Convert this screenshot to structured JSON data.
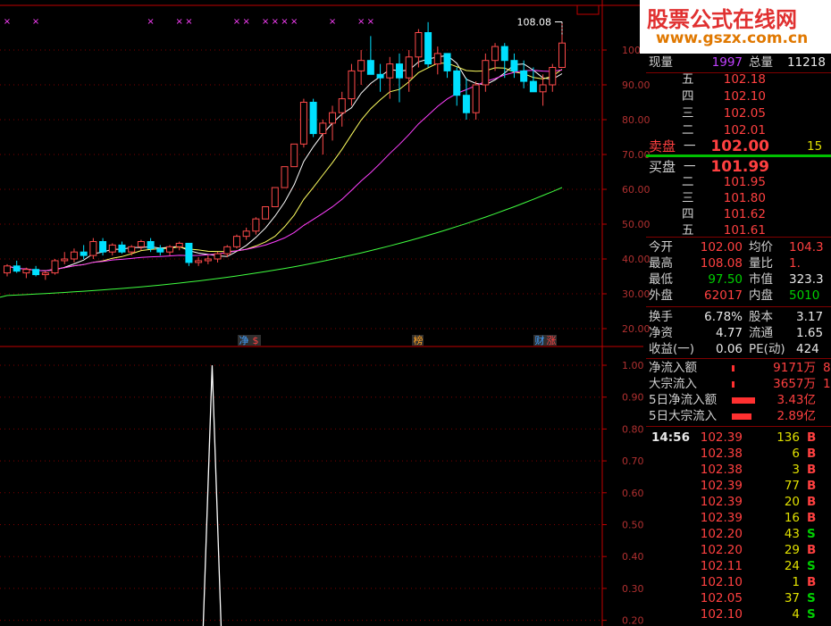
{
  "watermark": {
    "line1": "股票公式在线网",
    "line2": "www.gszx.com.cn"
  },
  "chart_data": {
    "type": "candlestick",
    "high_marker": "108.08",
    "price_axis": [
      "100.00",
      "90.00",
      "80.00",
      "70.00",
      "60.00",
      "50.00",
      "40.00",
      "30.00",
      "20.00"
    ],
    "indicator_axis": [
      "1.00",
      "0.90",
      "0.80",
      "0.70",
      "0.60",
      "0.50",
      "0.40",
      "0.30",
      "0.20"
    ],
    "event_tags": [
      "净",
      "$",
      "榜",
      "财",
      "涨"
    ],
    "candles": [
      [
        36,
        38.5,
        35,
        38
      ],
      [
        38,
        39.5,
        36,
        36.5
      ],
      [
        36,
        37.5,
        34.5,
        37
      ],
      [
        37,
        38,
        35,
        35.5
      ],
      [
        35.5,
        36.5,
        34,
        36
      ],
      [
        36,
        40,
        35.5,
        39.5
      ],
      [
        39.5,
        42,
        38.5,
        40
      ],
      [
        40,
        43,
        39,
        42
      ],
      [
        42,
        44,
        40,
        41
      ],
      [
        41,
        46,
        40,
        45
      ],
      [
        45,
        46,
        41,
        42
      ],
      [
        42,
        44.5,
        41,
        44
      ],
      [
        44,
        45,
        41.5,
        42
      ],
      [
        42,
        44,
        41,
        43.5
      ],
      [
        43.5,
        45.5,
        42.5,
        45
      ],
      [
        45,
        46,
        42,
        43
      ],
      [
        43,
        44,
        41,
        42
      ],
      [
        42,
        44,
        41,
        43.5
      ],
      [
        43.5,
        45,
        42.5,
        44.5
      ],
      [
        44.5,
        44.5,
        38,
        39
      ],
      [
        39,
        40.5,
        38,
        39.5
      ],
      [
        39.5,
        41,
        38.5,
        40
      ],
      [
        40,
        42,
        39,
        41.5
      ],
      [
        41.5,
        44,
        40.5,
        43.5
      ],
      [
        43.5,
        47,
        43,
        46.5
      ],
      [
        46.5,
        49,
        45.5,
        48
      ],
      [
        48,
        52,
        47,
        51.5
      ],
      [
        51.5,
        55,
        51.5,
        55
      ],
      [
        55,
        60.5,
        55,
        60.5
      ],
      [
        60.5,
        66.5,
        60.5,
        66.5
      ],
      [
        66.5,
        73,
        66.5,
        73
      ],
      [
        73,
        86,
        72,
        85
      ],
      [
        85,
        86,
        75,
        76
      ],
      [
        76,
        80,
        70,
        79
      ],
      [
        79,
        84,
        74,
        82
      ],
      [
        82,
        88,
        78,
        86
      ],
      [
        86,
        96,
        84,
        94
      ],
      [
        94,
        100,
        90,
        97
      ],
      [
        97,
        104,
        93,
        93
      ],
      [
        93,
        96,
        88,
        92
      ],
      [
        92,
        98,
        86,
        96
      ],
      [
        96,
        99,
        85,
        92
      ],
      [
        92,
        100,
        88,
        98
      ],
      [
        98,
        106,
        95,
        105
      ],
      [
        105,
        108,
        95,
        96
      ],
      [
        96,
        101,
        93,
        99
      ],
      [
        99,
        97,
        92,
        94
      ],
      [
        94,
        95,
        84,
        87
      ],
      [
        87,
        92,
        80,
        82
      ],
      [
        82,
        91,
        80,
        90
      ],
      [
        90,
        99,
        88,
        97
      ],
      [
        97,
        102,
        94,
        101
      ],
      [
        101,
        102,
        92,
        97
      ],
      [
        97,
        99,
        92,
        94
      ],
      [
        94,
        97,
        89,
        91
      ],
      [
        91,
        95,
        88,
        88
      ],
      [
        88,
        93,
        84,
        90
      ],
      [
        90,
        96,
        88,
        95
      ],
      [
        95,
        108.08,
        95,
        102
      ]
    ],
    "indicator": {
      "spike_index": 19,
      "spike_value": 1.0
    }
  },
  "quote": {
    "now_vol_label": "现量",
    "now_vol": "1997",
    "total_vol_label": "总量",
    "total_vol": "11218",
    "sell_levels": [
      {
        "name": "五",
        "price": "102.18"
      },
      {
        "name": "四",
        "price": "102.10"
      },
      {
        "name": "三",
        "price": "102.05"
      },
      {
        "name": "二",
        "price": "102.01"
      },
      {
        "name": "一",
        "price": ""
      }
    ],
    "sell_label": "卖盘",
    "sell_one": "一",
    "sell_price": "102.00",
    "sell_qty": "15",
    "buy_label": "买盘",
    "buy_one": "一",
    "buy_price": "101.99",
    "buy_levels": [
      {
        "name": "二",
        "price": "101.95"
      },
      {
        "name": "三",
        "price": "101.80"
      },
      {
        "name": "四",
        "price": "101.62"
      },
      {
        "name": "五",
        "price": "101.61"
      }
    ],
    "stats": [
      {
        "l1": "今开",
        "v1": "102.00",
        "c1": "red",
        "l2": "均价",
        "v2": "104.3",
        "c2": "red"
      },
      {
        "l1": "最高",
        "v1": "108.08",
        "c1": "red",
        "l2": "量比",
        "v2": "1.",
        "c2": "red"
      },
      {
        "l1": "最低",
        "v1": "97.50",
        "c1": "grn",
        "l2": "市值",
        "v2": "323.3",
        "c2": "wht"
      },
      {
        "l1": "外盘",
        "v1": "62017",
        "c1": "red",
        "l2": "内盘",
        "v2": "5010",
        "c2": "grn"
      }
    ],
    "fund": [
      {
        "l1": "换手",
        "v1": "6.78%",
        "l2": "股本",
        "v2": "3.17"
      },
      {
        "l1": "净资",
        "v1": "4.77",
        "l2": "流通",
        "v2": "1.65"
      },
      {
        "l1": "收益(一)",
        "v1": "0.06",
        "l2": "PE(动)",
        "v2": "424"
      }
    ],
    "flows": [
      {
        "label": "净流入额",
        "value": "9171万",
        "tail": "8",
        "bar": 0.12
      },
      {
        "label": "大宗流入",
        "value": "3657万",
        "tail": "1",
        "bar": 0.05
      },
      {
        "label": "5日净流入额",
        "value": "3.43亿",
        "tail": "",
        "bar": 1.0
      },
      {
        "label": "5日大宗流入",
        "value": "2.89亿",
        "tail": "",
        "bar": 0.85
      }
    ],
    "ticks_time": "14:56",
    "ticks": [
      {
        "p": "102.39",
        "v": "136",
        "s": "B"
      },
      {
        "p": "102.38",
        "v": "6",
        "s": "B"
      },
      {
        "p": "102.38",
        "v": "3",
        "s": "B"
      },
      {
        "p": "102.39",
        "v": "77",
        "s": "B"
      },
      {
        "p": "102.39",
        "v": "20",
        "s": "B"
      },
      {
        "p": "102.39",
        "v": "16",
        "s": "B"
      },
      {
        "p": "102.20",
        "v": "43",
        "s": "S"
      },
      {
        "p": "102.20",
        "v": "29",
        "s": "B"
      },
      {
        "p": "102.11",
        "v": "24",
        "s": "S"
      },
      {
        "p": "102.10",
        "v": "1",
        "s": "B"
      },
      {
        "p": "102.05",
        "v": "37",
        "s": "S"
      },
      {
        "p": "102.10",
        "v": "4",
        "s": "S"
      }
    ]
  },
  "colors": {
    "up": "#ff4a4a",
    "down": "#00e0ff",
    "ma5": "#ffffff",
    "ma10": "#ffff60",
    "ma20": "#ff40ff",
    "ma60": "#40ff40",
    "grid": "#800000",
    "axis": "#c00000"
  }
}
